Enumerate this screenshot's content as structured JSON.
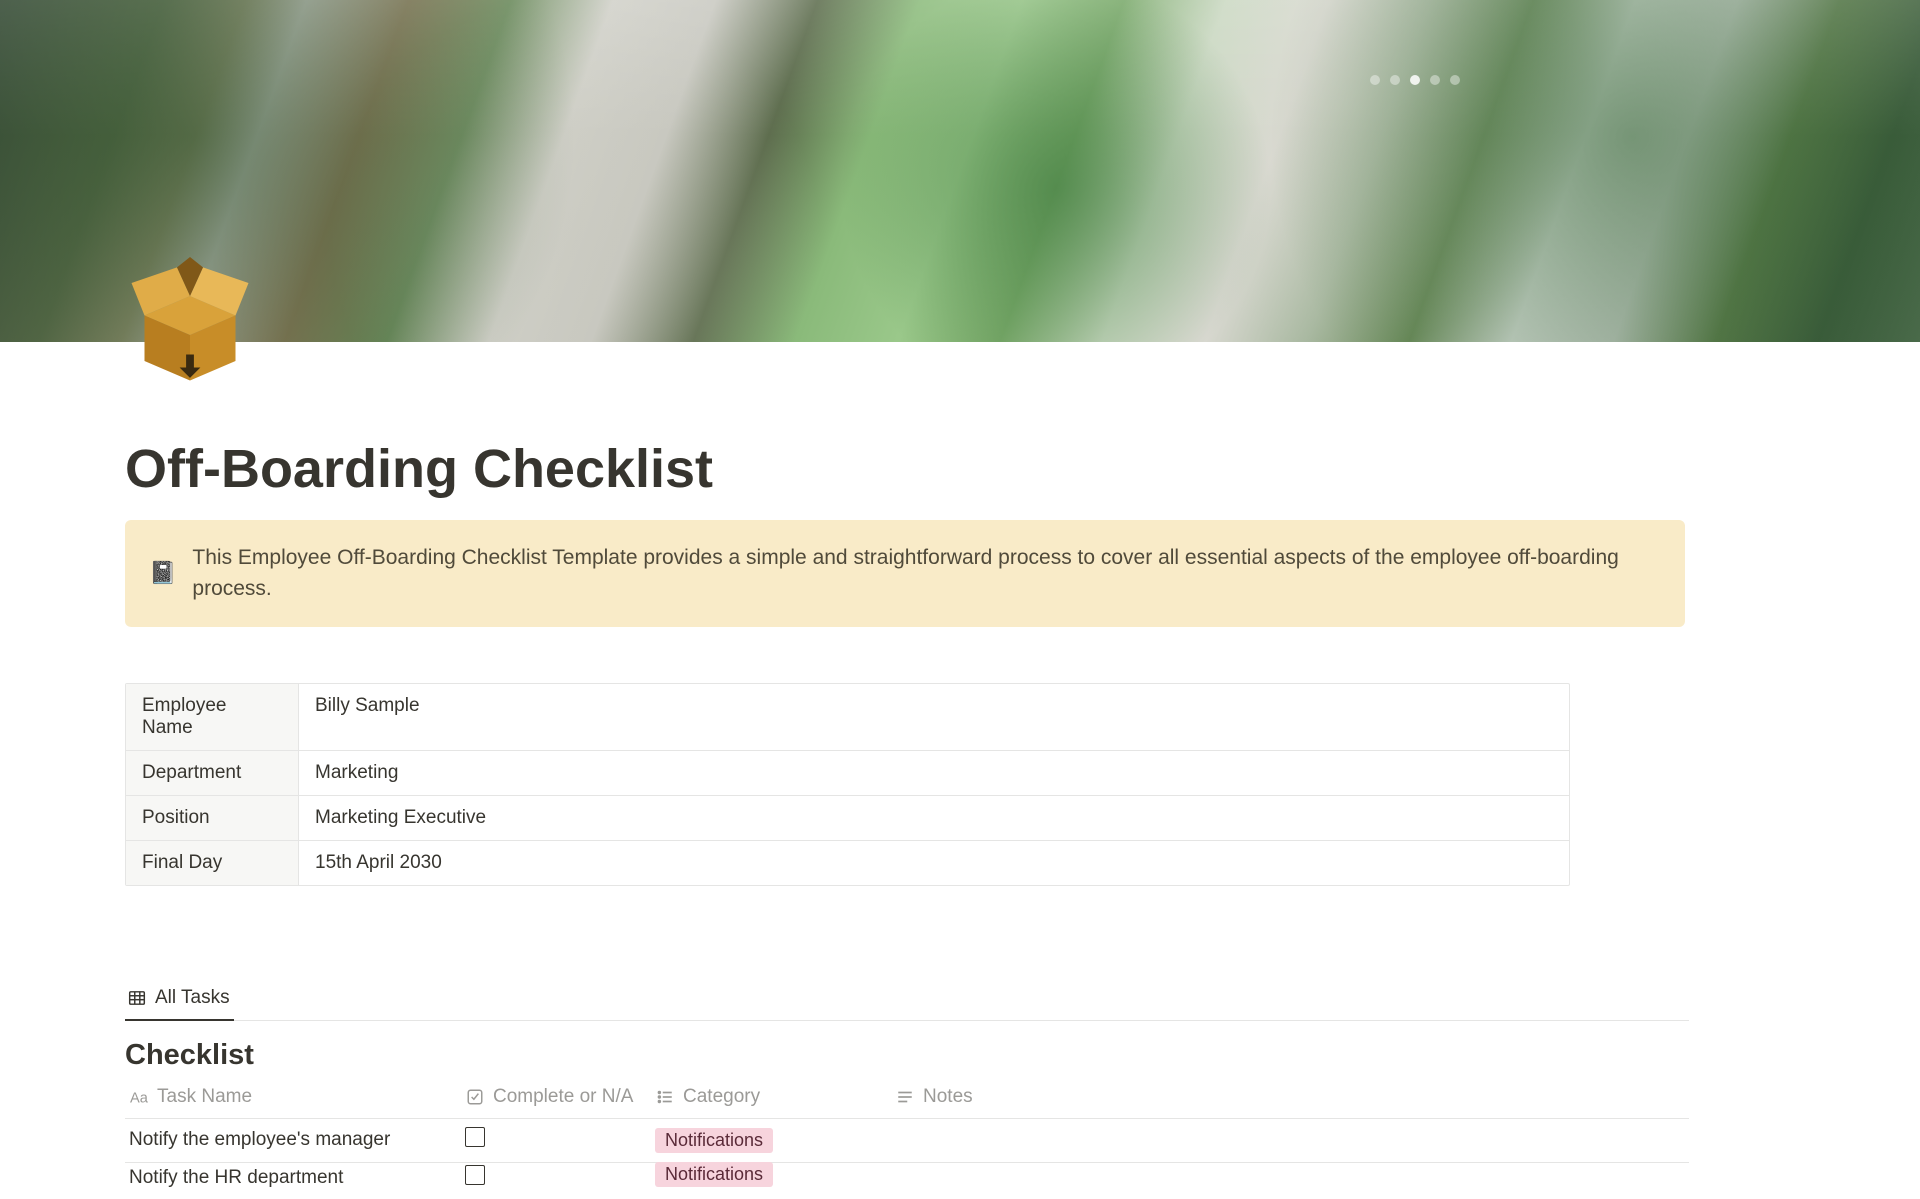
{
  "page": {
    "title": "Off-Boarding Checklist"
  },
  "callout": {
    "icon": "📓",
    "text": "This Employee Off-Boarding Checklist Template provides a simple and straightforward process to cover all essential aspects of the employee off-boarding process."
  },
  "info": {
    "rows": [
      {
        "label": "Employee Name",
        "value": "Billy Sample"
      },
      {
        "label": "Department",
        "value": "Marketing"
      },
      {
        "label": "Position",
        "value": "Marketing Executive"
      },
      {
        "label": "Final Day",
        "value": "15th April 2030"
      }
    ]
  },
  "database": {
    "tab_label": "All Tasks",
    "title": "Checklist",
    "columns": {
      "task": "Task Name",
      "complete": "Complete or N/A",
      "category": "Category",
      "notes": "Notes"
    },
    "rows": [
      {
        "task": "Notify the employee's manager",
        "complete": false,
        "category": "Notifications",
        "notes": ""
      },
      {
        "task": "Notify the HR department",
        "complete": false,
        "category": "Notifications",
        "notes": ""
      }
    ]
  }
}
